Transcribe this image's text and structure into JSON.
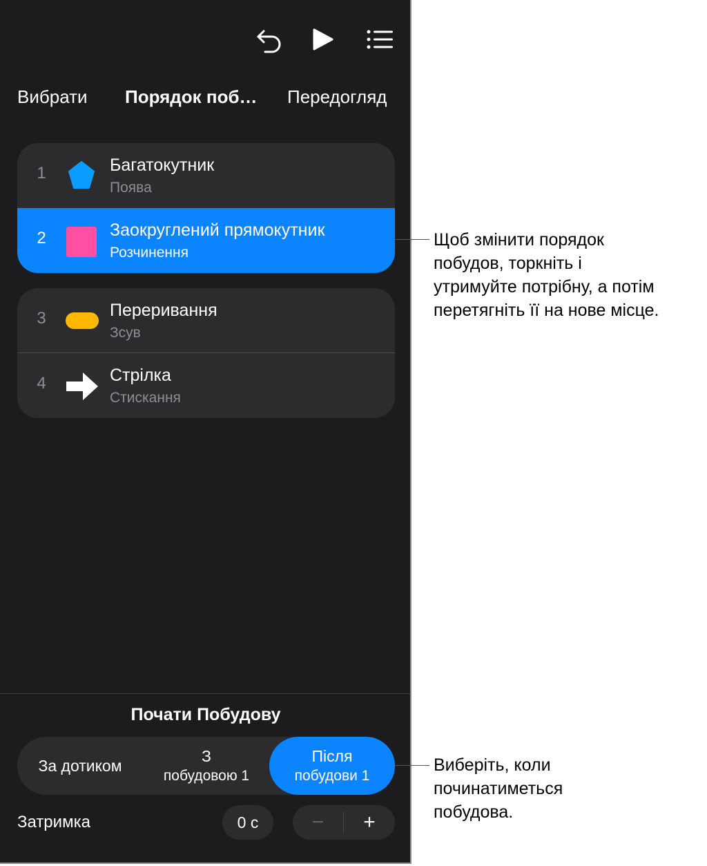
{
  "toolbar": {
    "undo_icon": "undo-icon",
    "play_icon": "play-icon",
    "list_icon": "list-icon"
  },
  "tabs": [
    {
      "label": "Вибрати"
    },
    {
      "label": "Порядок поб…"
    },
    {
      "label": "Передогляд"
    }
  ],
  "builds": [
    {
      "number": "1",
      "title": "Багатокутник",
      "effect": "Поява",
      "icon": "pentagon-icon",
      "color": "#0a9dff"
    },
    {
      "number": "2",
      "title": "Заокруглений прямокутник",
      "effect": "Розчинення",
      "icon": "rounded-square-icon",
      "color": "#ff4fa3"
    },
    {
      "number": "3",
      "title": "Переривання",
      "effect": "Зсув",
      "icon": "pill-icon",
      "color": "#ffb800"
    },
    {
      "number": "4",
      "title": "Стрілка",
      "effect": "Стискання",
      "icon": "arrow-right-icon",
      "color": "#ffffff"
    }
  ],
  "start": {
    "title": "Почати Побудову",
    "options": [
      {
        "line1": "За дотиком",
        "line2": ""
      },
      {
        "line1": "З",
        "line2": "побудовою 1"
      },
      {
        "line1": "Після",
        "line2": "побудови 1"
      }
    ],
    "selected_index": 2
  },
  "delay": {
    "label": "Затримка",
    "value": "0 с",
    "minus": "−",
    "plus": "+"
  },
  "callouts": {
    "reorder": "Щоб змінити порядок\nпобудов, торкніть і\nутримуйте потрібну, а потім\nперетягніть її на нове місце.",
    "start": "Виберіть, коли\nпочинатиметься\nпобудова."
  },
  "colors": {
    "accent": "#0a84ff",
    "panel_bg": "#1c1c1e",
    "group_bg": "#2c2c2e"
  }
}
